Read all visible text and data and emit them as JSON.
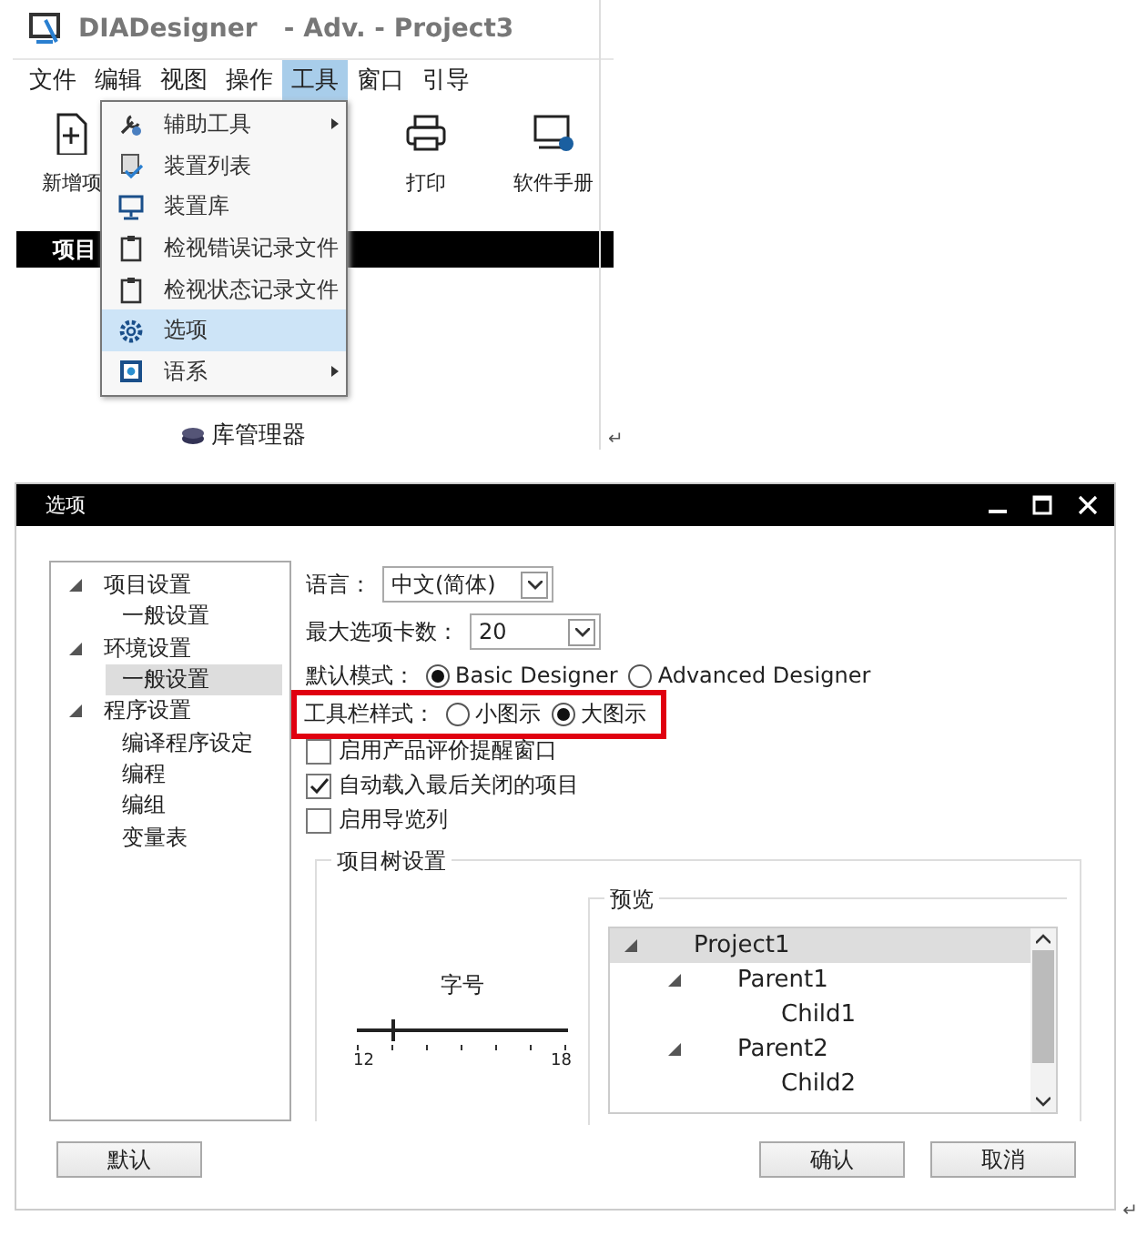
{
  "app_window": {
    "title": "DIADesigner",
    "subtitle": "- Adv. - Project3",
    "menu": [
      {
        "label": "文件",
        "selected": false
      },
      {
        "label": "编辑",
        "selected": false
      },
      {
        "label": "视图",
        "selected": false
      },
      {
        "label": "操作",
        "selected": false
      },
      {
        "label": "工具",
        "selected": true
      },
      {
        "label": "窗口",
        "selected": false
      },
      {
        "label": "引导",
        "selected": false
      }
    ],
    "toolbar": [
      {
        "label": "新增项"
      },
      {
        "label": "打印"
      },
      {
        "label": "软件手册"
      }
    ],
    "panel_header": "项目",
    "tree_item": "库管理器",
    "dropdown": [
      {
        "label": "辅助工具",
        "submenu": true,
        "selected": false
      },
      {
        "label": "装置列表",
        "submenu": false,
        "selected": false
      },
      {
        "label": "装置库",
        "submenu": false,
        "selected": false
      },
      {
        "label": "检视错误记录文件",
        "submenu": false,
        "selected": false
      },
      {
        "label": "检视状态记录文件",
        "submenu": false,
        "selected": false
      },
      {
        "label": "选项",
        "submenu": false,
        "selected": true
      },
      {
        "label": "语系",
        "submenu": true,
        "selected": false
      }
    ],
    "paragraph_mark": "↵"
  },
  "options_dialog": {
    "title": "选项",
    "nav_tree": [
      {
        "label": "项目设置",
        "expanded": true,
        "selected": false,
        "children": [
          {
            "label": "一般设置",
            "selected": false
          }
        ]
      },
      {
        "label": "环境设置",
        "expanded": true,
        "selected": false,
        "children": [
          {
            "label": "一般设置",
            "selected": true
          }
        ]
      },
      {
        "label": "程序设置",
        "expanded": true,
        "selected": false,
        "children": [
          {
            "label": "编译程序设定",
            "selected": false
          },
          {
            "label": "编程",
            "selected": false
          },
          {
            "label": "编组",
            "selected": false
          },
          {
            "label": "变量表",
            "selected": false
          }
        ]
      }
    ],
    "language": {
      "label": "语言：",
      "value": "中文(简体)"
    },
    "max_tabs": {
      "label": "最大选项卡数：",
      "value": "20"
    },
    "default_mode": {
      "label": "默认模式：",
      "highlighted": false,
      "options": [
        {
          "label": "Basic Designer",
          "selected": true
        },
        {
          "label": "Advanced Designer",
          "selected": false
        }
      ]
    },
    "toolbar_style": {
      "label": "工具栏样式：",
      "highlighted": true,
      "options": [
        {
          "label": "小图示",
          "selected": false
        },
        {
          "label": "大图示",
          "selected": true
        }
      ]
    },
    "checkboxes": [
      {
        "label": "启用产品评价提醒窗口",
        "checked": false
      },
      {
        "label": "自动载入最后关闭的项目",
        "checked": true
      },
      {
        "label": "启用导览列",
        "checked": false
      }
    ],
    "project_tree_settings": {
      "title": "项目树设置",
      "font_size": {
        "label": "字号",
        "level": 0.16,
        "min": "12",
        "max": "18"
      },
      "preview": {
        "title": "预览",
        "tree": [
          {
            "label": "Project1",
            "expanded": true,
            "selected": true,
            "children": [
              {
                "label": "Parent1",
                "expanded": true,
                "selected": false,
                "children": [
                  {
                    "label": "Child1",
                    "selected": false
                  }
                ]
              },
              {
                "label": "Parent2",
                "expanded": true,
                "selected": false,
                "children": [
                  {
                    "label": "Child2",
                    "selected": false
                  }
                ]
              }
            ]
          }
        ]
      }
    },
    "default_button": "默认",
    "buttons": [
      "确认",
      "取消"
    ],
    "paragraph_mark": "↵"
  }
}
